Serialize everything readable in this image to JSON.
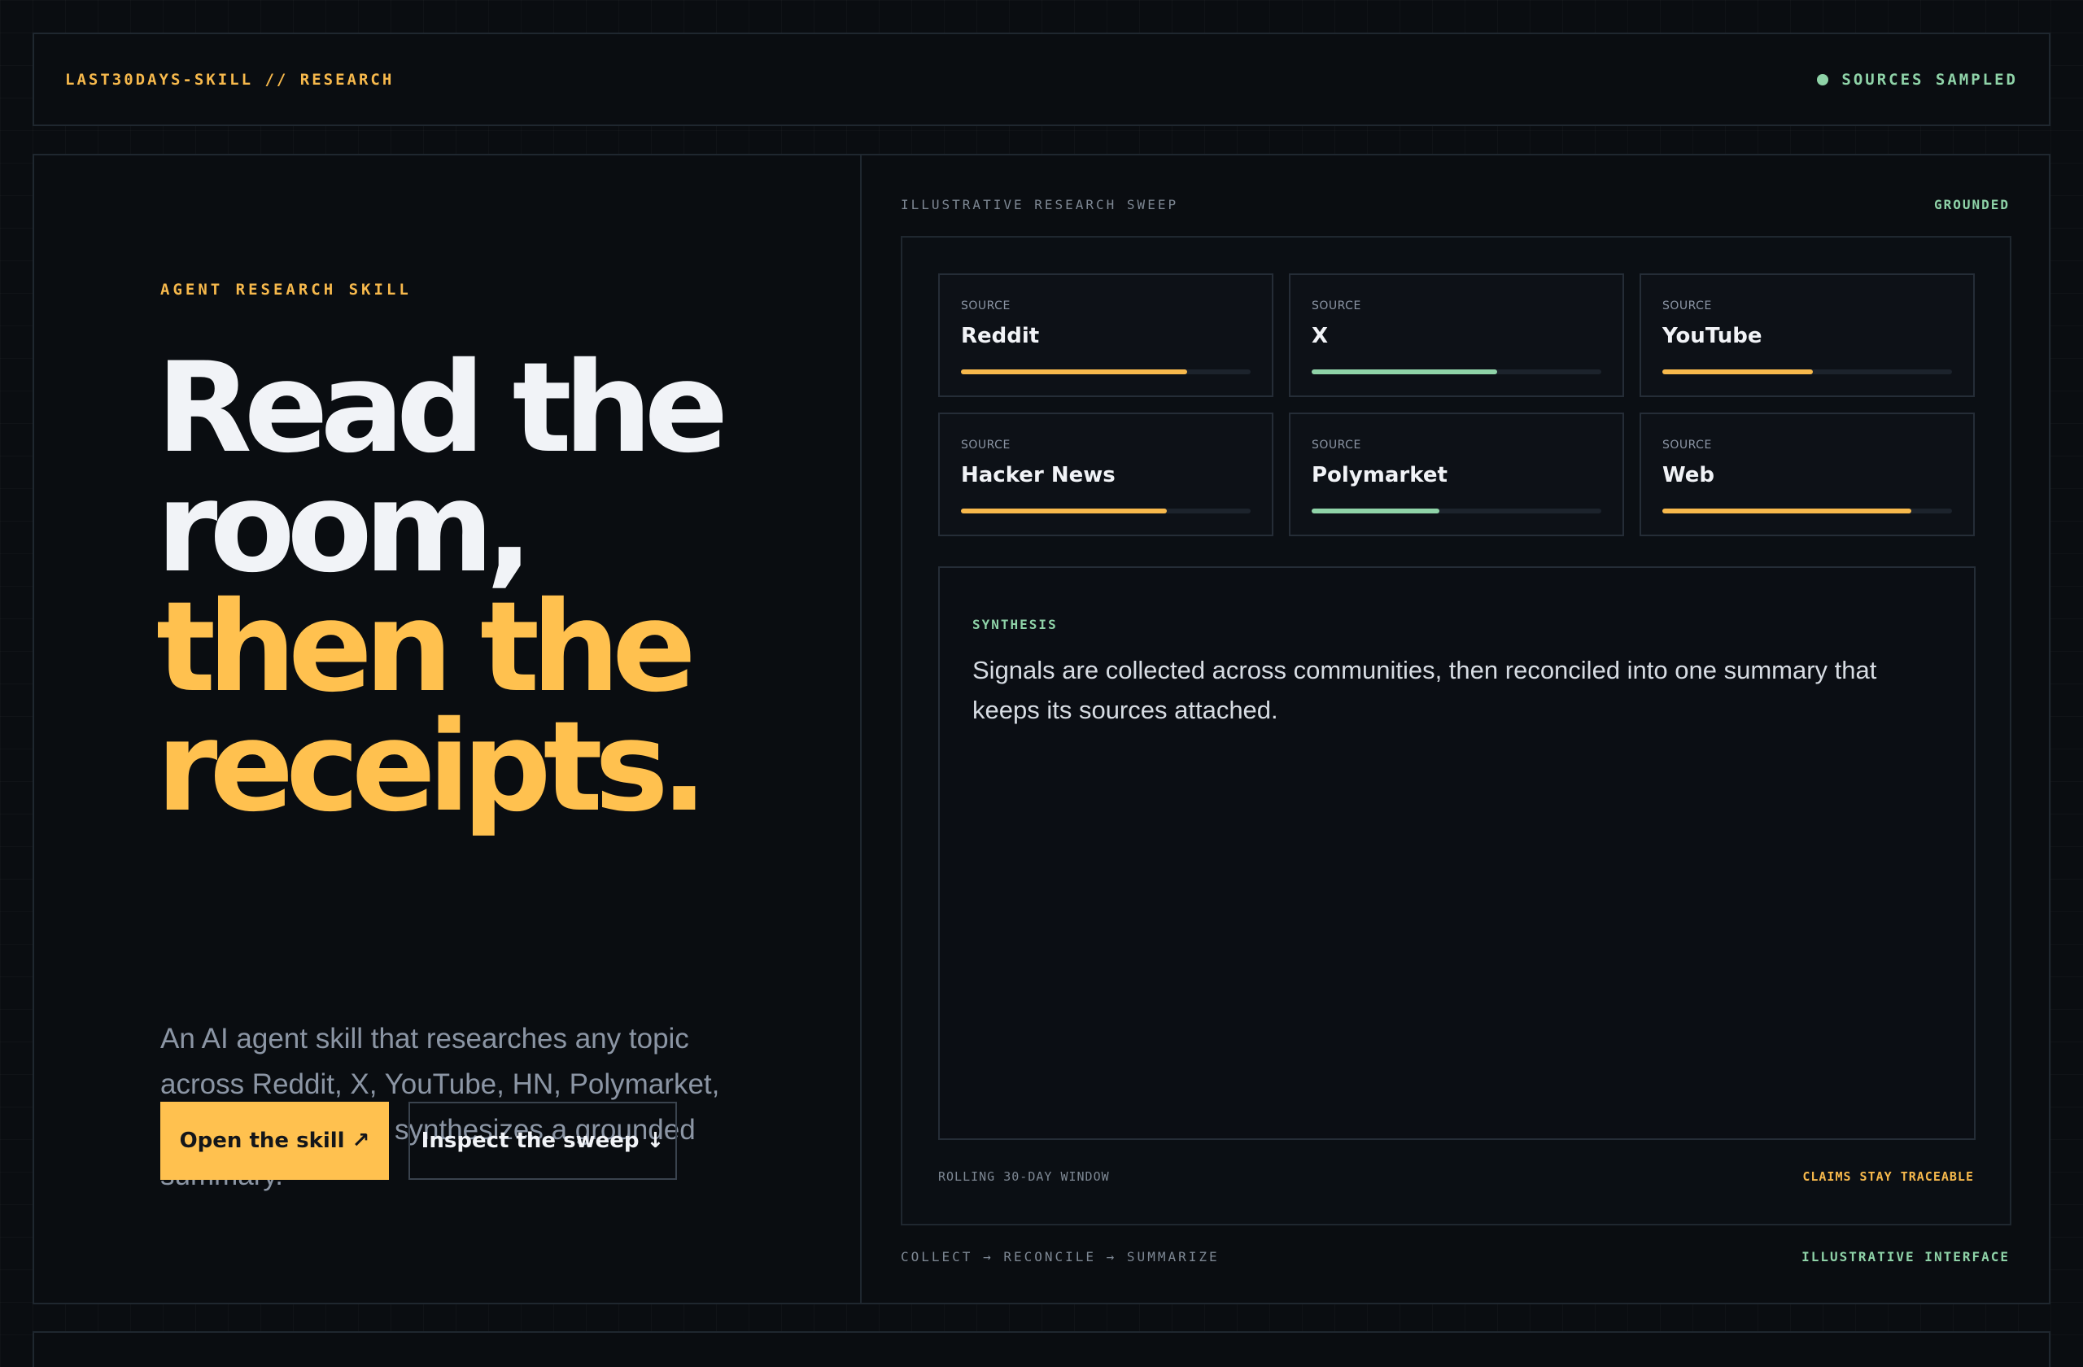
{
  "topbar": {
    "brand": "LAST30DAYS-SKILL // RESEARCH",
    "status": "SOURCES SAMPLED"
  },
  "hero": {
    "eyebrow": "AGENT RESEARCH SKILL",
    "headline_line1": "Read the",
    "headline_line2": "room,",
    "headline_line3": "then the",
    "headline_line4": "receipts.",
    "lede": "An AI agent skill that researches any topic across Reddit, X, YouTube, HN, Polymarket, and the web, then synthesizes a grounded summary.",
    "primary_button": "Open the skill ↗",
    "secondary_button": "Inspect the sweep ↓"
  },
  "sweep": {
    "title": "ILLUSTRATIVE RESEARCH SWEEP",
    "badge": "GROUNDED",
    "sources": [
      {
        "kicker": "SOURCE",
        "name": "Reddit",
        "level": 0.78,
        "color": "#f7b94c"
      },
      {
        "kicker": "SOURCE",
        "name": "X",
        "level": 0.64,
        "color": "#8fd3a8"
      },
      {
        "kicker": "SOURCE",
        "name": "YouTube",
        "level": 0.52,
        "color": "#f7b94c"
      },
      {
        "kicker": "SOURCE",
        "name": "Hacker News",
        "level": 0.71,
        "color": "#f7b94c"
      },
      {
        "kicker": "SOURCE",
        "name": "Polymarket",
        "level": 0.44,
        "color": "#8fd3a8"
      },
      {
        "kicker": "SOURCE",
        "name": "Web",
        "level": 0.86,
        "color": "#f7b94c"
      }
    ],
    "synthesis_label": "SYNTHESIS",
    "synthesis_text": "Signals are collected across communities, then reconciled into one summary that keeps its sources attached.",
    "window_label": "ROLLING 30-DAY WINDOW",
    "traceable_label": "CLAIMS STAY TRACEABLE"
  },
  "footer": {
    "pipeline": "COLLECT → RECONCILE → SUMMARIZE",
    "note": "ILLUSTRATIVE INTERFACE"
  },
  "colors": {
    "accent": "#ffc14f",
    "green": "#8fd3a8",
    "background": "#0a0d11"
  }
}
